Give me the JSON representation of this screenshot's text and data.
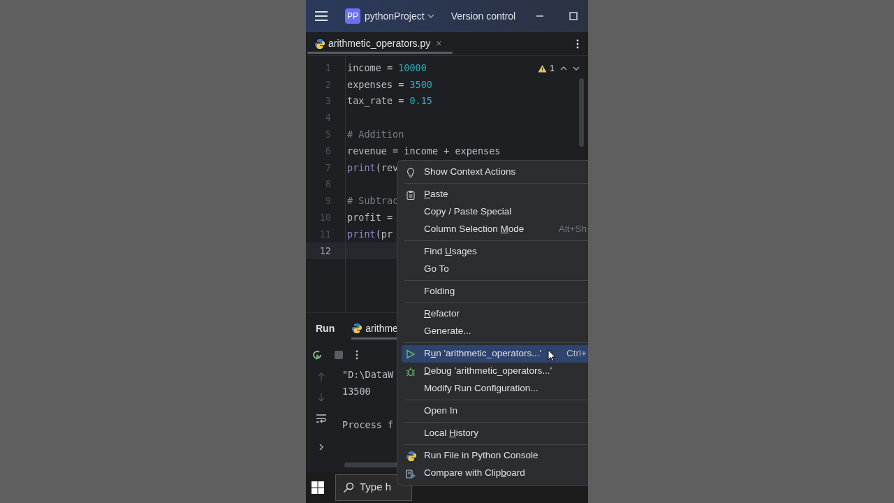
{
  "title_bar": {
    "project_badge": "PP",
    "project": "pythonProject",
    "vcs": "Version control"
  },
  "editor_tab": {
    "file": "arithmetic_operators.py",
    "close": "×",
    "selected": true
  },
  "inspection": {
    "warnings": "1"
  },
  "code_lines": [
    {
      "number": "1",
      "current": false,
      "tokens": [
        {
          "kind": "name",
          "text": "income = "
        },
        {
          "kind": "num",
          "text": "10000"
        }
      ]
    },
    {
      "number": "2",
      "current": false,
      "tokens": [
        {
          "kind": "name",
          "text": "expenses = "
        },
        {
          "kind": "num",
          "text": "3500"
        }
      ]
    },
    {
      "number": "3",
      "current": false,
      "tokens": [
        {
          "kind": "name",
          "text": "tax_rate = "
        },
        {
          "kind": "num",
          "text": "0.15"
        }
      ]
    },
    {
      "number": "4",
      "current": false
    },
    {
      "number": "5",
      "current": false,
      "tokens": [
        {
          "kind": "comment",
          "text": "# Addition"
        }
      ]
    },
    {
      "number": "6",
      "current": false,
      "tokens": [
        {
          "kind": "name",
          "text": "revenue = income + expenses"
        }
      ]
    },
    {
      "number": "7",
      "current": false,
      "tokens": [
        {
          "kind": "func",
          "text": "print"
        },
        {
          "kind": "name",
          "text": "(rev"
        }
      ]
    },
    {
      "number": "8",
      "current": false
    },
    {
      "number": "9",
      "current": false,
      "tokens": [
        {
          "kind": "comment",
          "text": "# Subtrac"
        }
      ]
    },
    {
      "number": "10",
      "current": false,
      "tokens": [
        {
          "kind": "name",
          "text": "profit ="
        }
      ]
    },
    {
      "number": "11",
      "current": false,
      "tokens": [
        {
          "kind": "func",
          "text": "print"
        },
        {
          "kind": "name",
          "text": "(pr"
        }
      ]
    },
    {
      "number": "12",
      "current": true
    }
  ],
  "run_panel": {
    "tabs": [
      {
        "label": "Run",
        "kind": "title",
        "selected": false
      },
      {
        "label": "arithme",
        "kind": "file",
        "selected": true
      }
    ],
    "output": [
      "\"D:\\DataW",
      "13500",
      "Process f"
    ]
  },
  "taskbar": {
    "search_placeholder": "Type h"
  },
  "context_menu": [
    {
      "kind": "item",
      "label": [
        {
          "text": "Show Context Actions",
          "underlined": false
        }
      ],
      "selected": false
    },
    {
      "kind": "separator"
    },
    {
      "kind": "item",
      "label": [
        {
          "text": "P",
          "underlined": true
        },
        {
          "text": "aste",
          "underlined": false
        }
      ],
      "selected": false
    },
    {
      "kind": "item",
      "label": [
        {
          "text": "Copy / Paste Special",
          "underlined": false
        }
      ],
      "selected": false
    },
    {
      "kind": "item",
      "label": [
        {
          "text": "Column Selection ",
          "underlined": false
        },
        {
          "text": "M",
          "underlined": true
        },
        {
          "text": "ode",
          "underlined": false
        }
      ],
      "shortcut": "Alt+Sh",
      "selected": false
    },
    {
      "kind": "separator"
    },
    {
      "kind": "item",
      "label": [
        {
          "text": "Find ",
          "underlined": false
        },
        {
          "text": "U",
          "underlined": true
        },
        {
          "text": "sages",
          "underlined": false
        }
      ],
      "selected": false
    },
    {
      "kind": "item",
      "label": [
        {
          "text": "Go To",
          "underlined": false
        }
      ],
      "selected": false
    },
    {
      "kind": "separator"
    },
    {
      "kind": "item",
      "label": [
        {
          "text": "Folding",
          "underlined": false
        }
      ],
      "selected": false
    },
    {
      "kind": "separator"
    },
    {
      "kind": "item",
      "label": [
        {
          "text": "R",
          "underlined": true
        },
        {
          "text": "efactor",
          "underlined": false
        }
      ],
      "selected": false
    },
    {
      "kind": "item",
      "label": [
        {
          "text": "Generate...",
          "underlined": false
        }
      ],
      "selected": false
    },
    {
      "kind": "separator"
    },
    {
      "kind": "item",
      "label": [
        {
          "text": "R",
          "underlined": false
        },
        {
          "text": "u",
          "underlined": true
        },
        {
          "text": "n 'arithmetic_operators...'",
          "underlined": false
        }
      ],
      "shortcut": "Ctrl+",
      "selected": true
    },
    {
      "kind": "item",
      "label": [
        {
          "text": "D",
          "underlined": true
        },
        {
          "text": "ebug 'arithmetic_operators...'",
          "underlined": false
        }
      ],
      "selected": false
    },
    {
      "kind": "item",
      "label": [
        {
          "text": "Modify Run Configuration...",
          "underlined": false
        }
      ],
      "selected": false
    },
    {
      "kind": "separator"
    },
    {
      "kind": "item",
      "label": [
        {
          "text": "Open In",
          "underlined": false
        }
      ],
      "selected": false
    },
    {
      "kind": "separator"
    },
    {
      "kind": "item",
      "label": [
        {
          "text": "Local ",
          "underlined": false
        },
        {
          "text": "H",
          "underlined": true
        },
        {
          "text": "istory",
          "underlined": false
        }
      ],
      "selected": false
    },
    {
      "kind": "separator"
    },
    {
      "kind": "item",
      "label": [
        {
          "text": "Run File in Python Console",
          "underlined": false
        }
      ],
      "selected": false
    },
    {
      "kind": "item",
      "label": [
        {
          "text": "Compare with Clip",
          "underlined": false
        },
        {
          "text": "b",
          "underlined": true
        },
        {
          "text": "oard",
          "underlined": false
        }
      ],
      "selected": false
    }
  ]
}
